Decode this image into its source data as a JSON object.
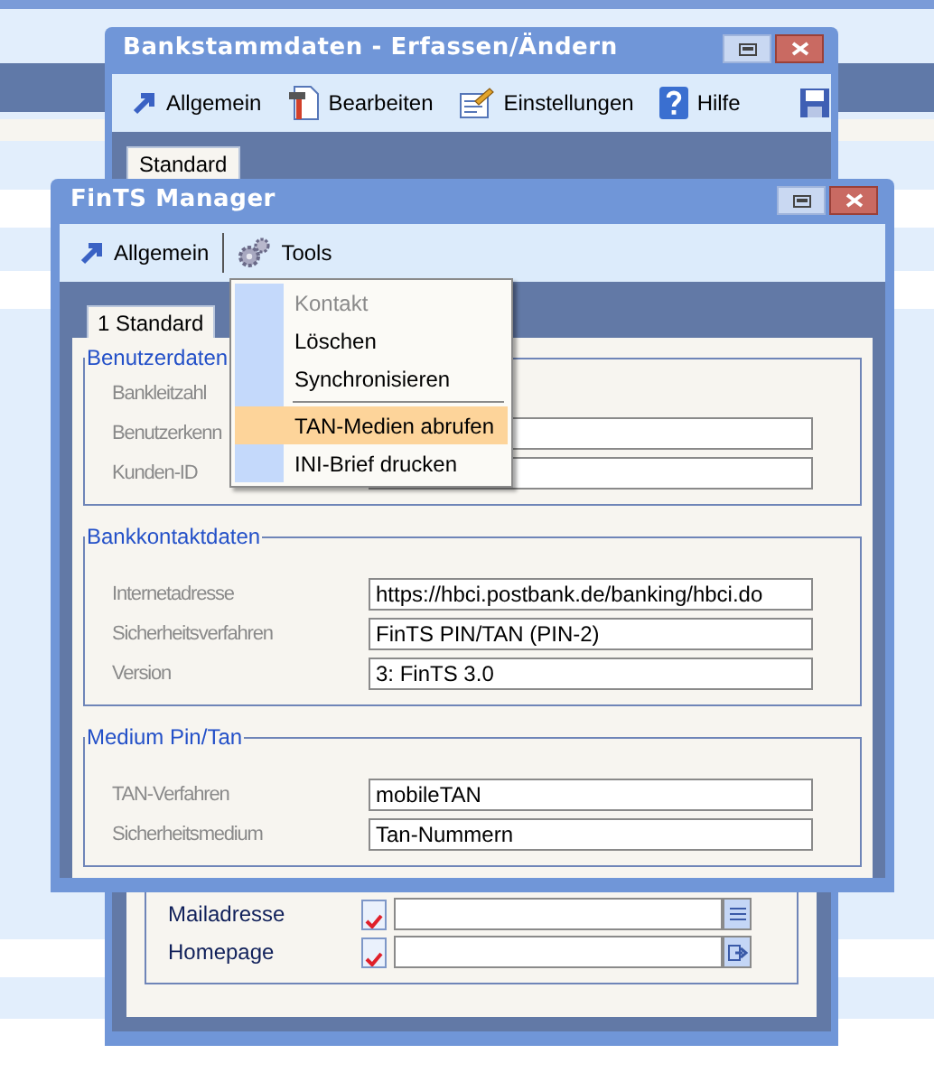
{
  "back_window": {
    "title": "Bankstammdaten - Erfassen/Ändern",
    "toolbar": [
      {
        "label": "Allgemein",
        "kind": "arrow"
      },
      {
        "label": "Bearbeiten",
        "kind": "edit"
      },
      {
        "label": "Einstellungen",
        "kind": "settings"
      },
      {
        "label": "Hilfe",
        "kind": "help"
      },
      {
        "kind": "save"
      }
    ],
    "tabs": [
      {
        "label": "Standard",
        "selected": true
      }
    ],
    "rows": [
      {
        "label": "Mailadresse",
        "checked": true,
        "kind": "list"
      },
      {
        "label": "Homepage",
        "checked": true,
        "kind": "open"
      }
    ]
  },
  "front_window": {
    "title": "FinTS Manager",
    "toolbar": [
      {
        "label": "Allgemein",
        "kind": "arrow"
      },
      {
        "label": "Tools",
        "kind": "gears"
      }
    ],
    "tabs": [
      {
        "label": "1 Standard",
        "selected": true
      }
    ],
    "groups": [
      {
        "title": "Benutzerdaten",
        "fields": [
          {
            "label": "Bankleitzahl",
            "has_field": false
          },
          {
            "label": "Benutzerkenn",
            "has_field": true
          },
          {
            "label": "Kunden-ID",
            "has_field": true
          }
        ]
      },
      {
        "title": "Bankkontaktdaten",
        "fields": [
          {
            "label": "Internetadresse",
            "has_field": true,
            "value": "https://hbci.postbank.de/banking/hbci.do"
          },
          {
            "label": "Sicherheitsverfahren",
            "has_field": true,
            "value": "FinTS PIN/TAN (PIN-2)"
          },
          {
            "label": "Version",
            "has_field": true,
            "value": "3: FinTS 3.0"
          }
        ]
      },
      {
        "title": "Medium Pin/Tan",
        "fields": [
          {
            "label": "TAN-Verfahren",
            "has_field": true,
            "value": "mobileTAN"
          },
          {
            "label": "Sicherheitsmedium",
            "has_field": true,
            "value": "Tan-Nummern"
          }
        ]
      }
    ]
  },
  "menu": {
    "items": [
      {
        "kind": "item",
        "label": "Kontakt",
        "disabled": true,
        "selected": false
      },
      {
        "kind": "item",
        "label": "Löschen",
        "disabled": false,
        "selected": false
      },
      {
        "kind": "item",
        "label": "Synchronisieren",
        "disabled": false,
        "selected": false
      },
      {
        "kind": "separator"
      },
      {
        "kind": "item",
        "label": "TAN-Medien abrufen",
        "disabled": false,
        "selected": true
      },
      {
        "kind": "item",
        "label": "INI-Brief drucken",
        "disabled": false,
        "selected": false
      }
    ]
  }
}
